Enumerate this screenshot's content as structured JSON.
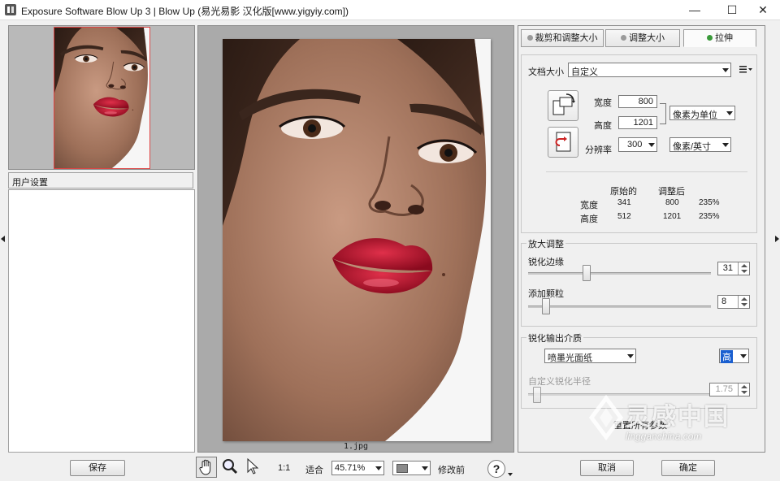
{
  "window": {
    "title": "Exposure Software Blow Up 3 | Blow Up  (易光易影 汉化版[www.yigyiy.com])",
    "minimize_glyph": "—",
    "maximize_glyph": "☐",
    "close_glyph": "✕"
  },
  "left_panel": {
    "user_settings_header": "用户设置",
    "save_label": "保存"
  },
  "preview": {
    "filename": "1.jpg"
  },
  "toolbar": {
    "ratio_label": "1:1",
    "fit_label": "适合",
    "zoom_value": "45.71%",
    "before_label": "修改前",
    "help_glyph": "?"
  },
  "tabs": [
    {
      "label": "裁剪和调整大小",
      "active": false
    },
    {
      "label": "调整大小",
      "active": false
    },
    {
      "label": "拉伸",
      "active": true
    }
  ],
  "document_size": {
    "label": "文档大小",
    "preset": "自定义",
    "width_label": "宽度",
    "width_value": "800",
    "height_label": "高度",
    "height_value": "1201",
    "unit": "像素为单位",
    "resolution_label": "分辨率",
    "resolution_value": "300",
    "resolution_unit": "像素/英寸"
  },
  "summary": {
    "original_header": "原始的",
    "adjusted_header": "调整后",
    "rows": [
      {
        "label": "宽度",
        "original": "341",
        "adjusted": "800",
        "percent": "235%"
      },
      {
        "label": "高度",
        "original": "512",
        "adjusted": "1201",
        "percent": "235%"
      }
    ]
  },
  "enlarge": {
    "group_label": "放大调整",
    "sharpen_edges_label": "锐化边缘",
    "sharpen_edges_value": "31",
    "sharpen_edges_level": 0.31,
    "add_grain_label": "添加颗粒",
    "add_grain_value": "8",
    "add_grain_level": 0.08
  },
  "output_sharpen": {
    "group_label": "锐化输出介质",
    "media": "喷墨光面纸",
    "amount": "高",
    "custom_radius_label": "自定义锐化半径",
    "custom_radius_value": "1.75",
    "reset_label": "重置所有参数"
  },
  "footer": {
    "cancel_label": "取消",
    "ok_label": "确定"
  },
  "watermark": {
    "chinese": "灵感中国",
    "url": "lingganchina.com"
  },
  "colors": {
    "accent_blue": "#1a5fd0",
    "lip_red": "#b8102a",
    "tab_dot": "#9a9a9a",
    "tab_dot_active": "#3a9a3a"
  }
}
